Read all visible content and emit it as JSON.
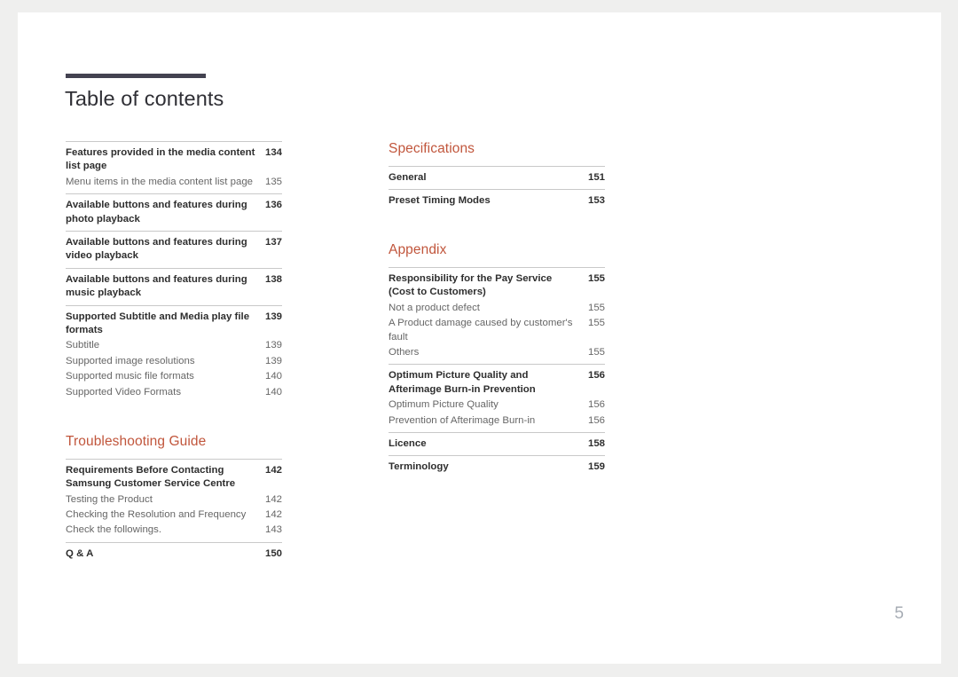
{
  "document": {
    "title": "Table of contents",
    "folio": "5",
    "accent_color": "#c1563c",
    "rule_color": "#434250",
    "page_background": "#ffffff",
    "canvas_background": "#efefee"
  },
  "columns": [
    {
      "name": "left",
      "blocks": [
        {
          "type": "group",
          "entries": [
            {
              "label": "Features provided in the media content list page",
              "page": "134",
              "level": "main",
              "wrap": true
            },
            {
              "label": "Menu items in the media content list page",
              "page": "135",
              "level": "sub"
            }
          ]
        },
        {
          "type": "group",
          "entries": [
            {
              "label": "Available buttons and features during photo playback",
              "page": "136",
              "level": "main",
              "wrap": true
            }
          ]
        },
        {
          "type": "group",
          "entries": [
            {
              "label": "Available buttons and features during video playback",
              "page": "137",
              "level": "main",
              "wrap": true
            }
          ]
        },
        {
          "type": "group",
          "entries": [
            {
              "label": "Available buttons and features during music playback",
              "page": "138",
              "level": "main",
              "wrap": true
            }
          ]
        },
        {
          "type": "group",
          "entries": [
            {
              "label": "Supported Subtitle and Media play file formats",
              "page": "139",
              "level": "main",
              "wrap": true
            },
            {
              "label": "Subtitle",
              "page": "139",
              "level": "sub"
            },
            {
              "label": "Supported image resolutions",
              "page": "139",
              "level": "sub"
            },
            {
              "label": "Supported music file formats",
              "page": "140",
              "level": "sub"
            },
            {
              "label": "Supported Video Formats",
              "page": "140",
              "level": "sub"
            }
          ]
        },
        {
          "type": "heading",
          "text": "Troubleshooting Guide"
        },
        {
          "type": "group",
          "entries": [
            {
              "label": "Requirements Before Contacting Samsung Customer Service Centre",
              "page": "142",
              "level": "main",
              "wrap": true
            },
            {
              "label": "Testing the Product",
              "page": "142",
              "level": "sub"
            },
            {
              "label": "Checking the Resolution and Frequency",
              "page": "142",
              "level": "sub"
            },
            {
              "label": "Check the followings.",
              "page": "143",
              "level": "sub"
            }
          ]
        },
        {
          "type": "group",
          "entries": [
            {
              "label": "Q & A",
              "page": "150",
              "level": "main"
            }
          ]
        }
      ]
    },
    {
      "name": "right",
      "blocks": [
        {
          "type": "heading",
          "text": "Specifications"
        },
        {
          "type": "group",
          "entries": [
            {
              "label": "General",
              "page": "151",
              "level": "main"
            }
          ]
        },
        {
          "type": "group",
          "entries": [
            {
              "label": "Preset Timing Modes",
              "page": "153",
              "level": "main"
            }
          ]
        },
        {
          "type": "heading",
          "text": "Appendix"
        },
        {
          "type": "group",
          "entries": [
            {
              "label": "Responsibility for the Pay Service (Cost to Customers)",
              "page": "155",
              "level": "main",
              "wrap": true
            },
            {
              "label": "Not a product defect",
              "page": "155",
              "level": "sub"
            },
            {
              "label": "A Product damage caused by customer's fault",
              "page": "155",
              "level": "sub",
              "wrap": true
            },
            {
              "label": "Others",
              "page": "155",
              "level": "sub"
            }
          ]
        },
        {
          "type": "group",
          "entries": [
            {
              "label": "Optimum Picture Quality and Afterimage Burn-in Prevention",
              "page": "156",
              "level": "main",
              "wrap": true
            },
            {
              "label": "Optimum Picture Quality",
              "page": "156",
              "level": "sub"
            },
            {
              "label": "Prevention of Afterimage Burn-in",
              "page": "156",
              "level": "sub"
            }
          ]
        },
        {
          "type": "group",
          "entries": [
            {
              "label": "Licence",
              "page": "158",
              "level": "main"
            }
          ]
        },
        {
          "type": "group",
          "entries": [
            {
              "label": "Terminology",
              "page": "159",
              "level": "main"
            }
          ]
        }
      ]
    }
  ]
}
